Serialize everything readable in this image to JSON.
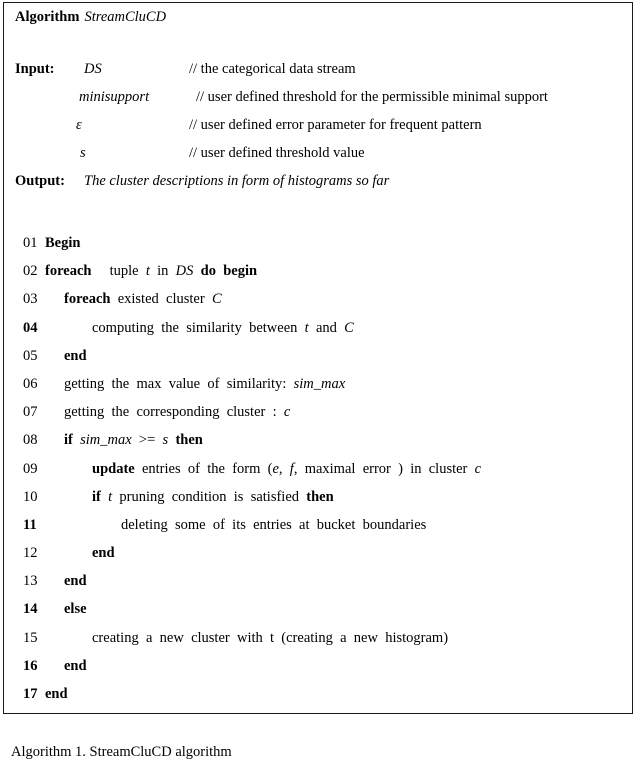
{
  "algorithm": {
    "title_keyword": "Algorithm",
    "title_name": "StreamCluCD",
    "io": {
      "input_label": "Input:",
      "output_label": "Output:",
      "params": [
        {
          "name": "DS",
          "comment": "// the categorical data stream"
        },
        {
          "name": "minisupport",
          "comment": "// user defined threshold for the permissible minimal support"
        },
        {
          "name": "ε",
          "comment": "// user defined error parameter for frequent pattern"
        },
        {
          "name": "s",
          "comment": "// user defined threshold value"
        }
      ],
      "output_value": "The cluster descriptions in form of histograms so far"
    },
    "lines": [
      {
        "num": "01",
        "num_bold": false,
        "indent": 0,
        "text": "Begin"
      },
      {
        "num": "02",
        "num_bold": false,
        "indent": 0,
        "text": "foreach    tuple t in DS do begin"
      },
      {
        "num": "03",
        "num_bold": false,
        "indent": 1,
        "text": "foreach existed cluster C"
      },
      {
        "num": "04",
        "num_bold": true,
        "indent": 2,
        "text": "computing the similarity between t and C"
      },
      {
        "num": "05",
        "num_bold": false,
        "indent": 1,
        "text": "end"
      },
      {
        "num": "06",
        "num_bold": false,
        "indent": 1,
        "text": "getting the max value of similarity: sim_max"
      },
      {
        "num": "07",
        "num_bold": false,
        "indent": 1,
        "text": "getting the corresponding cluster : c"
      },
      {
        "num": "08",
        "num_bold": false,
        "indent": 1,
        "text": "if sim_max >= s then"
      },
      {
        "num": "09",
        "num_bold": false,
        "indent": 2,
        "text": "update entries of the form (e, f, maximal error ) in cluster c"
      },
      {
        "num": "10",
        "num_bold": false,
        "indent": 2,
        "text": "if t pruning condition is satisfied then"
      },
      {
        "num": "11",
        "num_bold": true,
        "indent": 3,
        "text": "deleting some of its entries at bucket boundaries"
      },
      {
        "num": "12",
        "num_bold": false,
        "indent": 2,
        "text": "end"
      },
      {
        "num": "13",
        "num_bold": false,
        "indent": 1,
        "text": "end"
      },
      {
        "num": "14",
        "num_bold": true,
        "indent": 1,
        "text": "else"
      },
      {
        "num": "15",
        "num_bold": false,
        "indent": 2,
        "text": "creating a new cluster with t (creating a new histogram)"
      },
      {
        "num": "16",
        "num_bold": true,
        "indent": 1,
        "text": "end"
      },
      {
        "num": "17",
        "num_bold": true,
        "indent": 0,
        "text": "end"
      }
    ]
  },
  "caption": "Algorithm 1. StreamCluCD algorithm"
}
